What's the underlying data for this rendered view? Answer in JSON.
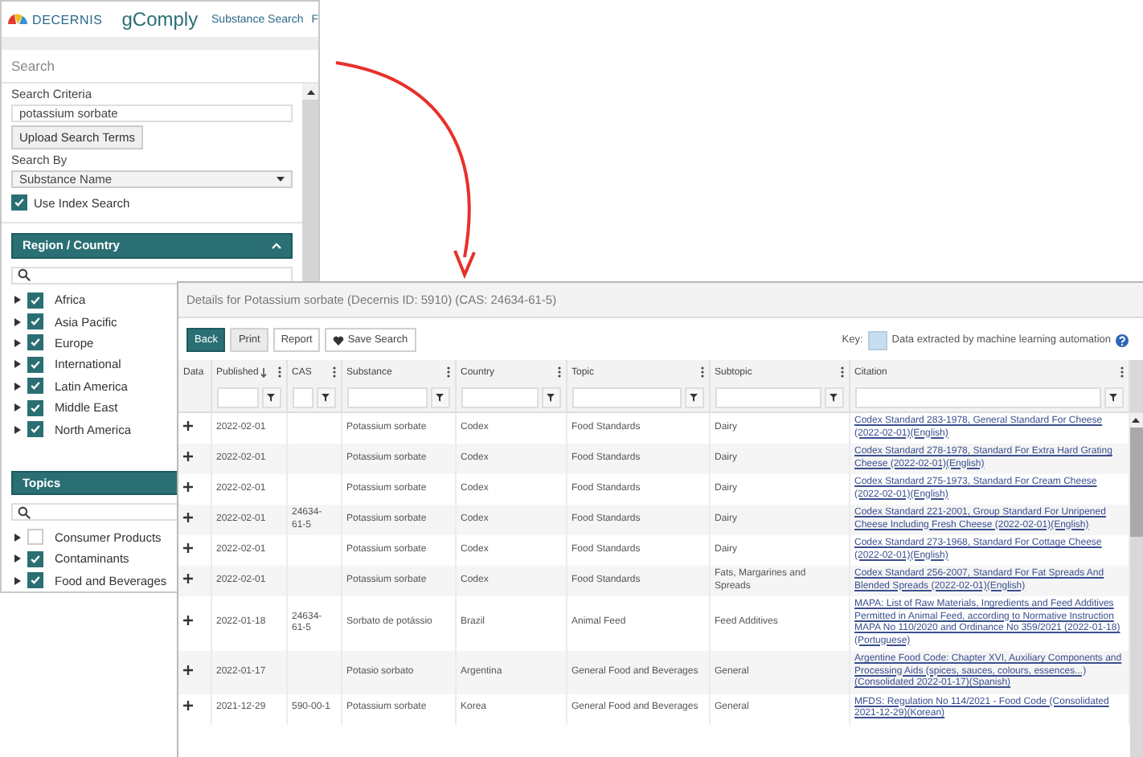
{
  "app": {
    "logo_text": "DECERNIS",
    "product": "gComply",
    "nav": [
      "Substance Search",
      "F"
    ]
  },
  "search_panel": {
    "title": "Search",
    "criteria_label": "Search Criteria",
    "criteria_value": "potassium sorbate",
    "upload_button": "Upload Search Terms",
    "search_by_label": "Search By",
    "search_by_value": "Substance Name",
    "index_search": {
      "label": "Use Index Search",
      "checked": true
    }
  },
  "region_section": {
    "title": "Region / Country",
    "expanded": true,
    "items": [
      {
        "label": "Africa",
        "checked": true
      },
      {
        "label": "Asia Pacific",
        "checked": true
      },
      {
        "label": "Europe",
        "checked": true
      },
      {
        "label": "International",
        "checked": true
      },
      {
        "label": "Latin America",
        "checked": true
      },
      {
        "label": "Middle East",
        "checked": true
      },
      {
        "label": "North America",
        "checked": true
      }
    ]
  },
  "topics_section": {
    "title": "Topics",
    "items": [
      {
        "label": "Consumer Products",
        "checked": false
      },
      {
        "label": "Contaminants",
        "checked": true
      },
      {
        "label": "Food and Beverages",
        "checked": true
      }
    ]
  },
  "details": {
    "title": "Details for Potassium sorbate (Decernis ID: 5910) (CAS: 24634-61-5)",
    "buttons": [
      {
        "label": "Back",
        "kind": "primary"
      },
      {
        "label": "Print",
        "kind": "muted"
      },
      {
        "label": "Report",
        "kind": "plain"
      },
      {
        "label": "Save Search",
        "kind": "favorite"
      }
    ],
    "key_label": "Key:",
    "key_text": "Data extracted by machine learning automation",
    "columns": [
      {
        "label": "Data",
        "kind": "expander",
        "sorted": false
      },
      {
        "label": "Published",
        "kind": "data",
        "sorted": true
      },
      {
        "label": "CAS",
        "kind": "data",
        "sorted": false
      },
      {
        "label": "Substance",
        "kind": "data",
        "sorted": false
      },
      {
        "label": "Country",
        "kind": "data",
        "sorted": false
      },
      {
        "label": "Topic",
        "kind": "data",
        "sorted": false
      },
      {
        "label": "Subtopic",
        "kind": "data",
        "sorted": false
      },
      {
        "label": "Citation",
        "kind": "data",
        "sorted": false
      }
    ],
    "rows": [
      {
        "published": "2022-02-01",
        "cas": "",
        "substance": "Potassium sorbate",
        "country": "Codex",
        "topic": "Food Standards",
        "subtopic": "Dairy",
        "citation": "Codex Standard 283-1978, General Standard For Cheese (2022-02-01)(English)"
      },
      {
        "published": "2022-02-01",
        "cas": "",
        "substance": "Potassium sorbate",
        "country": "Codex",
        "topic": "Food Standards",
        "subtopic": "Dairy",
        "citation": "Codex Standard 278-1978, Standard For Extra Hard Grating Cheese (2022-02-01)(English)"
      },
      {
        "published": "2022-02-01",
        "cas": "",
        "substance": "Potassium sorbate",
        "country": "Codex",
        "topic": "Food Standards",
        "subtopic": "Dairy",
        "citation": "Codex Standard 275-1973, Standard For Cream Cheese (2022-02-01)(English)"
      },
      {
        "published": "2022-02-01",
        "cas": "24634-61-5",
        "substance": "Potassium sorbate",
        "country": "Codex",
        "topic": "Food Standards",
        "subtopic": "Dairy",
        "citation": "Codex Standard 221-2001, Group Standard For Unripened Cheese Including Fresh Cheese (2022-02-01)(English)"
      },
      {
        "published": "2022-02-01",
        "cas": "",
        "substance": "Potassium sorbate",
        "country": "Codex",
        "topic": "Food Standards",
        "subtopic": "Dairy",
        "citation": "Codex Standard 273-1968, Standard For Cottage Cheese (2022-02-01)(English)"
      },
      {
        "published": "2022-02-01",
        "cas": "",
        "substance": "Potassium sorbate",
        "country": "Codex",
        "topic": "Food Standards",
        "subtopic": "Fats, Margarines and Spreads",
        "citation": "Codex Standard 256-2007, Standard For Fat Spreads And Blended Spreads (2022-02-01)(English)"
      },
      {
        "published": "2022-01-18",
        "cas": "24634-61-5",
        "substance": "Sorbato de potássio",
        "country": "Brazil",
        "topic": "Animal Feed",
        "subtopic": "Feed Additives",
        "citation": "MAPA: List of Raw Materials, Ingredients and Feed Additives Permitted in Animal Feed, according to Normative Instruction MAPA No 110/2020 and Ordinance No 359/2021 (2022-01-18)(Portuguese)"
      },
      {
        "published": "2022-01-17",
        "cas": "",
        "substance": "Potasio sorbato",
        "country": "Argentina",
        "topic": "General Food and Beverages",
        "subtopic": "General",
        "citation": "Argentine Food Code: Chapter XVI, Auxiliary Components and Processing Aids (spices, sauces, colours, essences...) (Consolidated 2022-01-17)(Spanish)"
      },
      {
        "published": "2021-12-29",
        "cas": "590-00-1",
        "substance": "Potassium sorbate",
        "country": "Korea",
        "topic": "General Food and Beverages",
        "subtopic": "General",
        "citation": "MFDS: Regulation No 114/2021 - Food Code (Consolidated 2021-12-29)(Korean)"
      }
    ]
  }
}
